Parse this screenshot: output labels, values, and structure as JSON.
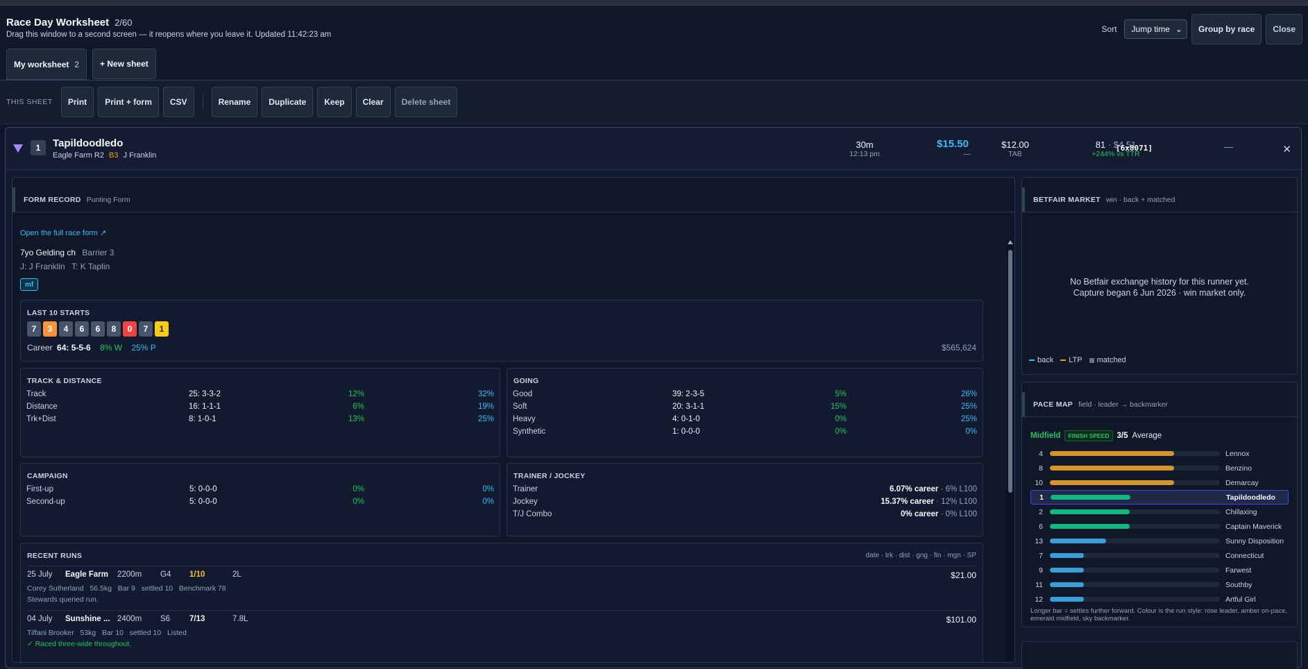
{
  "header": {
    "title": "Race Day Worksheet",
    "count": "2/60",
    "subtitle": "Drag this window to a second screen — it reopens where you leave it.  Updated 11:42:23 am",
    "sort_label": "Sort",
    "sort_value": "Jump time",
    "group_button": "Group by race",
    "close_button": "Close"
  },
  "tabs": [
    {
      "label": "My worksheet",
      "count": "2"
    },
    {
      "label": "+ New sheet"
    }
  ],
  "sheet_bar": {
    "label": "THIS SHEET",
    "buttons": [
      "Print",
      "Print + form",
      "CSV",
      "Rename",
      "Duplicate",
      "Keep",
      "Clear",
      "Delete sheet"
    ]
  },
  "runner": {
    "number": "1",
    "name": "Tapildoodledo",
    "venue": "Eagle Farm R2",
    "barrier": "B3",
    "jockey": "J Franklin",
    "time_to_jump": "30m",
    "jump_time": "12:13 pm",
    "best_price": "$15.50",
    "best_sub": "—",
    "tab_price": "$12.00",
    "tab_label": "TAB",
    "rating": "81",
    "rated_price": "· $4.51",
    "vs_ttr": "+244% vs TTR",
    "code": "[6x8071]",
    "minimize": "—",
    "close": "✕"
  },
  "form": {
    "title": "FORM RECORD",
    "source": "Punting Form",
    "link": "Open the full race form ↗",
    "desc": "7yo Gelding ch",
    "barrier": "Barrier 3",
    "jockey_line": "J: J Franklin",
    "trainer_line": "T: K Taplin",
    "tag": "mf",
    "last10_title": "LAST 10 STARTS",
    "last10": [
      {
        "v": "7",
        "c": "#475569"
      },
      {
        "v": "3",
        "c": "#fb923c"
      },
      {
        "v": "4",
        "c": "#475569"
      },
      {
        "v": "6",
        "c": "#475569"
      },
      {
        "v": "6",
        "c": "#475569"
      },
      {
        "v": "8",
        "c": "#475569"
      },
      {
        "v": "0",
        "c": "#ef4444"
      },
      {
        "v": "7",
        "c": "#475569"
      },
      {
        "v": "1",
        "c": "#facc15"
      }
    ],
    "career_label": "Career",
    "career": "64: 5-5-6",
    "career_w": "8% W",
    "career_p": "25% P",
    "prize": "$565,624",
    "track_distance": {
      "title": "TRACK & DISTANCE",
      "rows": [
        {
          "label": "Track",
          "rec": "25: 3-3-2",
          "w": "12%",
          "p": "32%"
        },
        {
          "label": "Distance",
          "rec": "16: 1-1-1",
          "w": "6%",
          "p": "19%"
        },
        {
          "label": "Trk+Dist",
          "rec": "8: 1-0-1",
          "w": "13%",
          "p": "25%"
        }
      ]
    },
    "going": {
      "title": "GOING",
      "rows": [
        {
          "label": "Good",
          "rec": "39: 2-3-5",
          "w": "5%",
          "p": "26%"
        },
        {
          "label": "Soft",
          "rec": "20: 3-1-1",
          "w": "15%",
          "p": "25%"
        },
        {
          "label": "Heavy",
          "rec": "4: 0-1-0",
          "w": "0%",
          "p": "25%"
        },
        {
          "label": "Synthetic",
          "rec": "1: 0-0-0",
          "w": "0%",
          "p": "0%"
        }
      ]
    },
    "campaign": {
      "title": "CAMPAIGN",
      "rows": [
        {
          "label": "First-up",
          "rec": "5: 0-0-0",
          "w": "0%",
          "p": "0%"
        },
        {
          "label": "Second-up",
          "rec": "5: 0-0-0",
          "w": "0%",
          "p": "0%"
        }
      ]
    },
    "trainer_jockey": {
      "title": "TRAINER / JOCKEY",
      "rows": [
        {
          "label": "Trainer",
          "career": "6.07% career",
          "l100": "· 6% L100"
        },
        {
          "label": "Jockey",
          "career": "15.37% career",
          "l100": "· 12% L100"
        },
        {
          "label": "T/J Combo",
          "career": "0% career",
          "l100": "· 0% L100"
        }
      ]
    },
    "recent": {
      "title": "RECENT RUNS",
      "legend": "date · trk · dist · gng · fin · mgn · SP",
      "runs": [
        {
          "date": "25 July",
          "track": "Eagle Farm",
          "dist": "2200m",
          "going": "G4",
          "fin": "1/10",
          "mgn": "2L",
          "sp": "$21.00",
          "detail": "Corey Sutherland   56.5kg   Bar 9   settled 10   Benchmark 78",
          "note": "Stewards queried run."
        },
        {
          "date": "04 July",
          "track": "Sunshine ...",
          "dist": "2400m",
          "going": "S6",
          "fin": "7/13",
          "mgn": "7.8L",
          "sp": "$101.00",
          "detail": "Tiffani Brooker   53kg   Bar 10   settled 10   Listed",
          "note": "✓ Raced three-wide throughout."
        }
      ]
    }
  },
  "betfair": {
    "title": "BETFAIR MARKET",
    "sub": "win · back + matched",
    "empty1": "No Betfair exchange history for this runner yet.",
    "empty2": "Capture began 6 Jun 2026 · win market only.",
    "legend_back": "back",
    "legend_ltp": "LTP",
    "legend_matched": "matched",
    "colors": {
      "back": "#38bdf8",
      "ltp": "#f59e0b",
      "matched": "#64748b"
    }
  },
  "pace": {
    "title": "PACE MAP",
    "sub": "field · leader → backmarker",
    "style": "Midfield",
    "badge": "FINISH SPEED",
    "score": "3/5",
    "score_word": "Average",
    "runners": [
      {
        "n": "4",
        "name": "Lennox",
        "lvl": 0.73,
        "c": "#d4962a"
      },
      {
        "n": "8",
        "name": "Benzino",
        "lvl": 0.73,
        "c": "#d4962a"
      },
      {
        "n": "10",
        "name": "Demarcay",
        "lvl": 0.73,
        "c": "#d4962a"
      },
      {
        "n": "1",
        "name": "Tapildoodledo",
        "lvl": 0.47,
        "c": "#10b981",
        "sel": true
      },
      {
        "n": "2",
        "name": "Chillaxing",
        "lvl": 0.47,
        "c": "#10b981"
      },
      {
        "n": "6",
        "name": "Captain Maverick",
        "lvl": 0.47,
        "c": "#10b981"
      },
      {
        "n": "13",
        "name": "Sunny Disposition",
        "lvl": 0.33,
        "c": "#3b9ed6"
      },
      {
        "n": "7",
        "name": "Connecticut",
        "lvl": 0.2,
        "c": "#3b9ed6"
      },
      {
        "n": "9",
        "name": "Farwest",
        "lvl": 0.2,
        "c": "#3b9ed6"
      },
      {
        "n": "11",
        "name": "Southby",
        "lvl": 0.2,
        "c": "#3b9ed6"
      },
      {
        "n": "12",
        "name": "Artful Girl",
        "lvl": 0.2,
        "c": "#3b9ed6"
      }
    ],
    "footnote": "Longer bar = settles further forward. Colour is the run style: rose leader, amber on-pace, emerald midfield, sky backmarker."
  }
}
